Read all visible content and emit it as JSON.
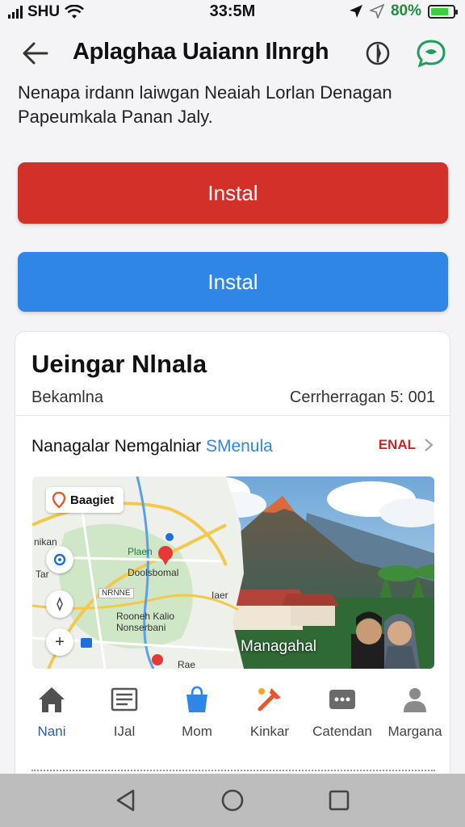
{
  "status_bar": {
    "carrier": "SHU",
    "time": "33:5M",
    "battery_text": "80%",
    "battery_level": 0.8
  },
  "app_bar": {
    "title": "Aplaghaa Uaiann Ilnrgh",
    "back_icon": "arrow-left-icon",
    "action_icons": [
      "compass-icon",
      "chat-bubble-icon"
    ]
  },
  "subtitle": "Nenapa irdann laiwgan Neaiah Lorlan Denagan Papeumkala Panan Jaly.",
  "buttons": {
    "install_primary": "Instal",
    "install_secondary": "Instal"
  },
  "colors": {
    "red_button": "#d4302a",
    "blue_button": "#2f86e6",
    "accent_red_text": "#c62828",
    "link_blue": "#2f86e6"
  },
  "card": {
    "title": "Ueingar Nlnala",
    "left_meta": "Bekamlna",
    "right_meta": "Cerrherragan 5: 001",
    "row": {
      "label": "Nanagalar Nemgalniar ",
      "link": "SMenula",
      "action": "ENAL"
    },
    "map": {
      "search_pill": "Baagiet",
      "labels": [
        "nikan",
        "Plaen",
        "Doolsbomal",
        "Iaer",
        "Rooneh Kalio",
        "Nonserbani",
        "NRNNE",
        "Tar",
        "Rae"
      ],
      "controls": [
        "locate-icon",
        "compass-icon",
        "zoom-in-icon"
      ]
    },
    "photo_caption": "Managahal",
    "nav": [
      {
        "icon": "home-icon",
        "label": "Nani"
      },
      {
        "icon": "document-icon",
        "label": "IJal"
      },
      {
        "icon": "bag-icon",
        "label": "Mom"
      },
      {
        "icon": "tools-icon",
        "label": "Kinkar"
      },
      {
        "icon": "calendar-icon",
        "label": "Catendan"
      },
      {
        "icon": "person-icon",
        "label": "Margana"
      }
    ]
  },
  "system_nav": [
    "back-triangle-icon",
    "home-circle-icon",
    "recents-square-icon"
  ]
}
